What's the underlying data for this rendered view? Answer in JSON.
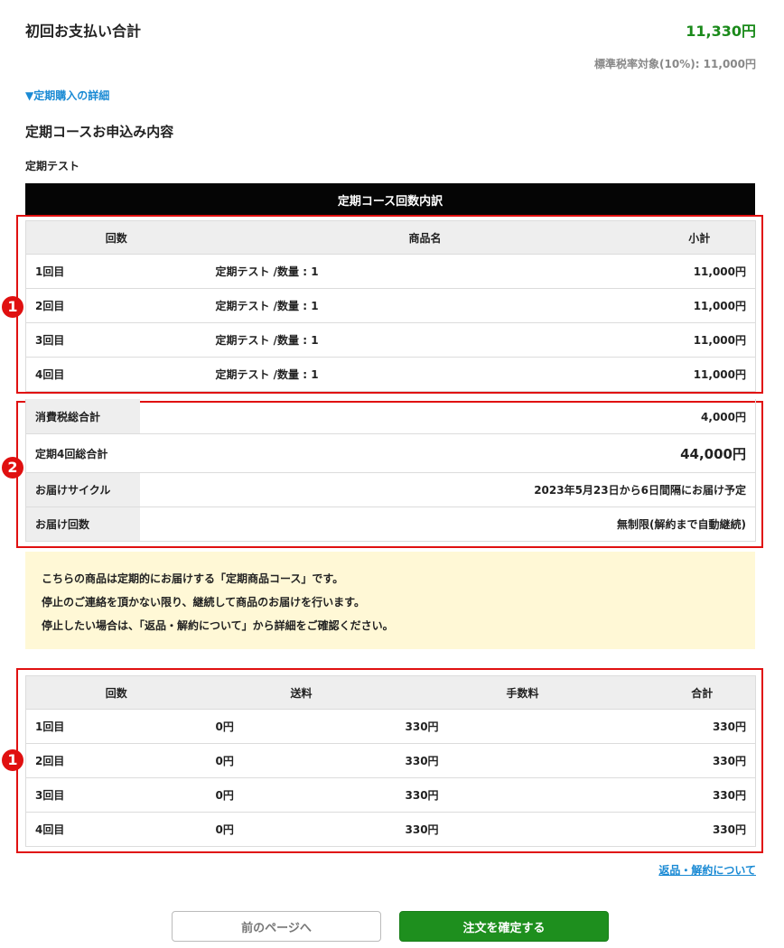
{
  "header": {
    "first_payment_label": "初回お支払い合計",
    "first_payment_amount": "11,330円",
    "tax_note": "標準税率対象(10%): 11,000円"
  },
  "detail_link": "▼定期購入の詳細",
  "course_section": {
    "title": "定期コースお申込み内容",
    "course_name": "定期テスト",
    "breakdown_title": "定期コース回数内訳"
  },
  "markers": {
    "one": "1",
    "two": "2"
  },
  "product_table": {
    "headers": [
      "回数",
      "商品名",
      "小計"
    ],
    "rows": [
      {
        "count": "1回目",
        "product": "定期テスト /数量 : 1",
        "subtotal": "11,000円"
      },
      {
        "count": "2回目",
        "product": "定期テスト /数量 : 1",
        "subtotal": "11,000円"
      },
      {
        "count": "3回目",
        "product": "定期テスト /数量 : 1",
        "subtotal": "11,000円"
      },
      {
        "count": "4回目",
        "product": "定期テスト /数量 : 1",
        "subtotal": "11,000円"
      }
    ]
  },
  "summary": {
    "tax_total_label": "消費税総合計",
    "tax_total_value": "4,000円",
    "grand_total_label": "定期4回総合計",
    "grand_total_value": "44,000円",
    "cycle_label": "お届けサイクル",
    "cycle_value": "2023年5月23日から6日間隔にお届け予定",
    "deliveries_label": "お届け回数",
    "deliveries_value": "無制限(解約まで自動継続)"
  },
  "notice": {
    "line1": "こちらの商品は定期的にお届けする「定期商品コース」です。",
    "line2": "停止のご連絡を頂かない限り、継続して商品のお届けを行います。",
    "line3": "停止したい場合は、「返品・解約について」から詳細をご確認ください。"
  },
  "fee_table": {
    "headers": [
      "回数",
      "送料",
      "手数料",
      "合計"
    ],
    "rows": [
      {
        "count": "1回目",
        "shipping": "0円",
        "fee": "330円",
        "total": "330円"
      },
      {
        "count": "2回目",
        "shipping": "0円",
        "fee": "330円",
        "total": "330円"
      },
      {
        "count": "3回目",
        "shipping": "0円",
        "fee": "330円",
        "total": "330円"
      },
      {
        "count": "4回目",
        "shipping": "0円",
        "fee": "330円",
        "total": "330円"
      }
    ]
  },
  "return_link": "返品・解約について",
  "buttons": {
    "back": "前のページへ",
    "confirm": "注文を確定する"
  },
  "colors": {
    "accent_green": "#1e8f1e",
    "link_blue": "#1a8ad4",
    "annotation_red": "#e01010",
    "notice_bg": "#fff8d6"
  }
}
